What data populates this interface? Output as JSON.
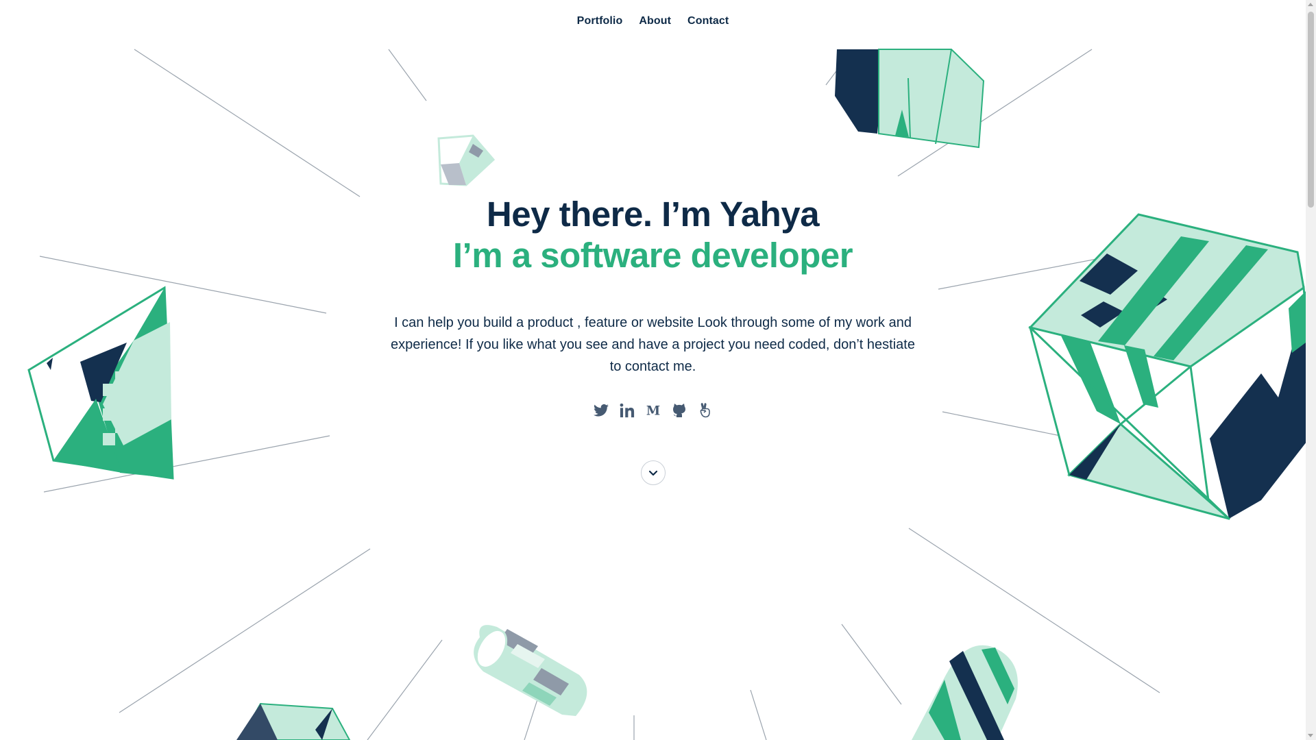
{
  "nav": {
    "items": [
      "Portfolio",
      "About",
      "Contact"
    ]
  },
  "hero": {
    "greeting": "Hey there. I’m Yahya",
    "role": "I’m a software developer",
    "bio": "I can help you build a product , feature or website Look through some of my work and experience! If you like what you see and have a project you need coded, don’t hestiate to contact me."
  },
  "social": {
    "icons": [
      "twitter-icon",
      "linkedin-icon",
      "medium-icon",
      "github-icon",
      "angellist-icon"
    ]
  },
  "colors": {
    "navy": "#0e2a47",
    "green": "#2bb07e",
    "mint": "#c4eadb",
    "line": "#9aa3ad"
  }
}
